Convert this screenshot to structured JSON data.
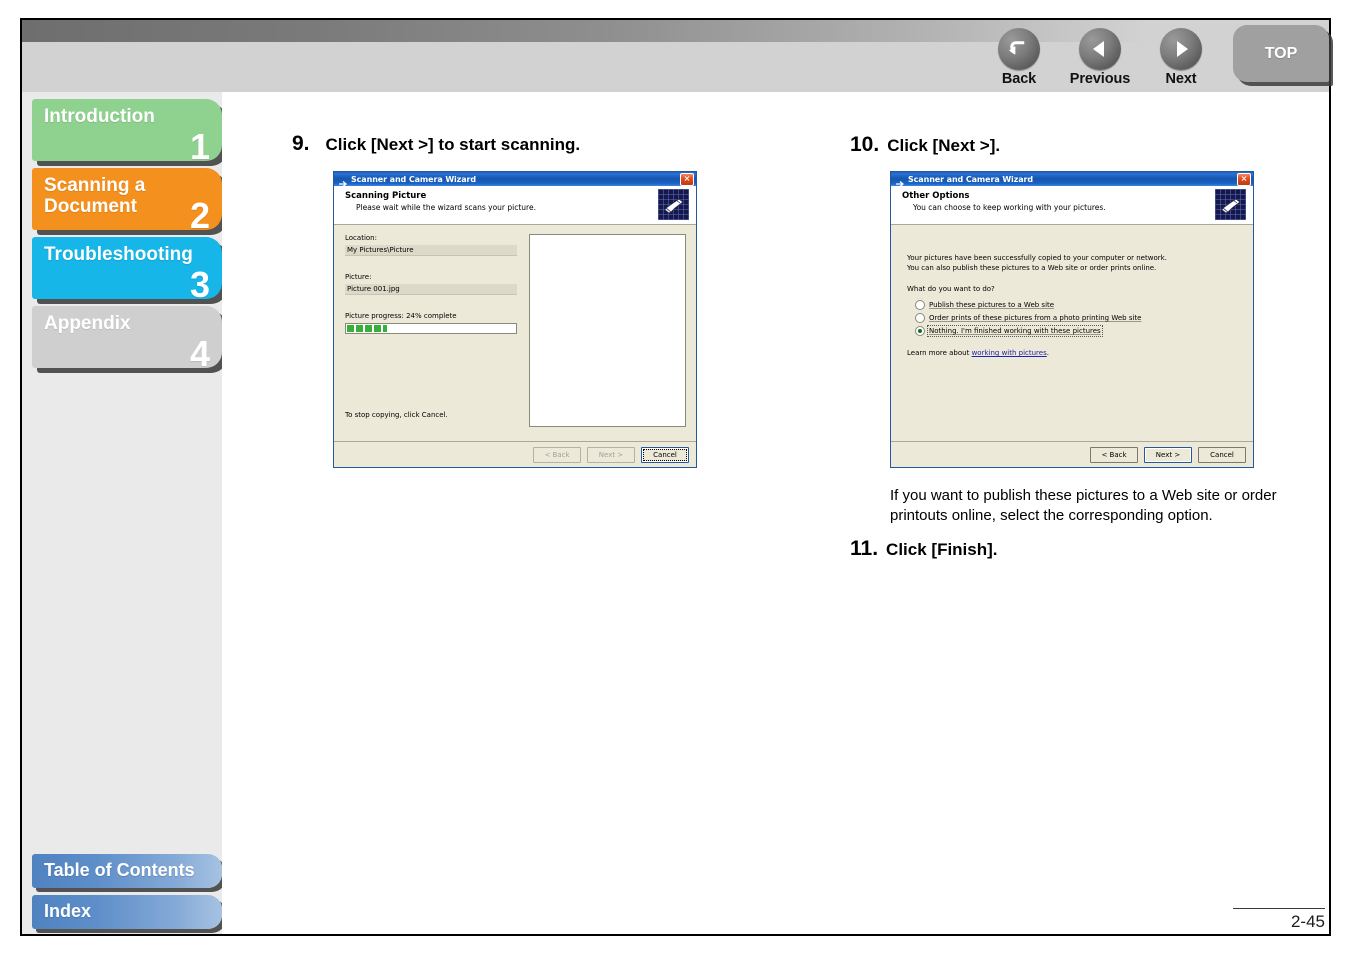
{
  "header": {
    "nav_buttons": [
      {
        "label": "Back",
        "icon": "back-arrow-icon"
      },
      {
        "label": "Previous",
        "icon": "left-triangle-icon"
      },
      {
        "label": "Next",
        "icon": "right-triangle-icon"
      }
    ],
    "top_tab_label": "TOP"
  },
  "sidebar": {
    "chapters": [
      {
        "label": "Introduction",
        "number": "1",
        "color": "#8fd18f"
      },
      {
        "label": "Scanning a\nDocument",
        "number": "2",
        "color": "#f4901e"
      },
      {
        "label": "Troubleshooting",
        "number": "3",
        "color": "#16b6e8"
      },
      {
        "label": "Appendix",
        "number": "4",
        "color": "#cfcfcf"
      }
    ],
    "bottom_links": [
      {
        "label": "Table of Contents"
      },
      {
        "label": "Index"
      }
    ]
  },
  "content": {
    "steps": [
      {
        "number": "9.",
        "text": "Click [Next >] to start scanning."
      },
      {
        "number": "10.",
        "text": "Click [Next >]."
      },
      {
        "number": "11.",
        "text": "Click [Finish]."
      }
    ],
    "note": "If you want to publish these pictures to a Web site or order printouts online, select the corresponding option.",
    "page_number": "2-45"
  },
  "dialog_scanning": {
    "title": "Scanner and Camera Wizard",
    "close_glyph": "×",
    "heading": "Scanning Picture",
    "subheading": "Please wait while the wizard scans your picture.",
    "location_label": "Location:",
    "location_value": "My Pictures\\Picture",
    "picture_label": "Picture:",
    "picture_value": "Picture 001.jpg",
    "progress_label": "Picture progress: 24% complete",
    "progress_percent": 24,
    "cancel_hint": "To stop copying, click Cancel.",
    "buttons": [
      {
        "label": "< Back",
        "state": "disabled"
      },
      {
        "label": "Next >",
        "state": "disabled"
      },
      {
        "label": "Cancel",
        "state": "focus"
      }
    ]
  },
  "dialog_options": {
    "title": "Scanner and Camera Wizard",
    "close_glyph": "×",
    "heading": "Other Options",
    "subheading": "You can choose to keep working with your pictures.",
    "para_line1": "Your pictures have been successfully copied to your computer or network.",
    "para_line2": "You can also publish these pictures to a Web site or order prints online.",
    "question": "What do you want to do?",
    "options": [
      {
        "label": "Publish these pictures to a Web site",
        "selected": false
      },
      {
        "label": "Order prints of these pictures from a photo printing Web site",
        "selected": false
      },
      {
        "label": "Nothing. I'm finished working with these pictures",
        "selected": true
      }
    ],
    "learn_more_prefix": "Learn more about ",
    "learn_more_link": "working with pictures",
    "learn_more_suffix": ".",
    "buttons": [
      {
        "label": "< Back",
        "state": "normal"
      },
      {
        "label": "Next >",
        "state": "default"
      },
      {
        "label": "Cancel",
        "state": "normal"
      }
    ]
  }
}
